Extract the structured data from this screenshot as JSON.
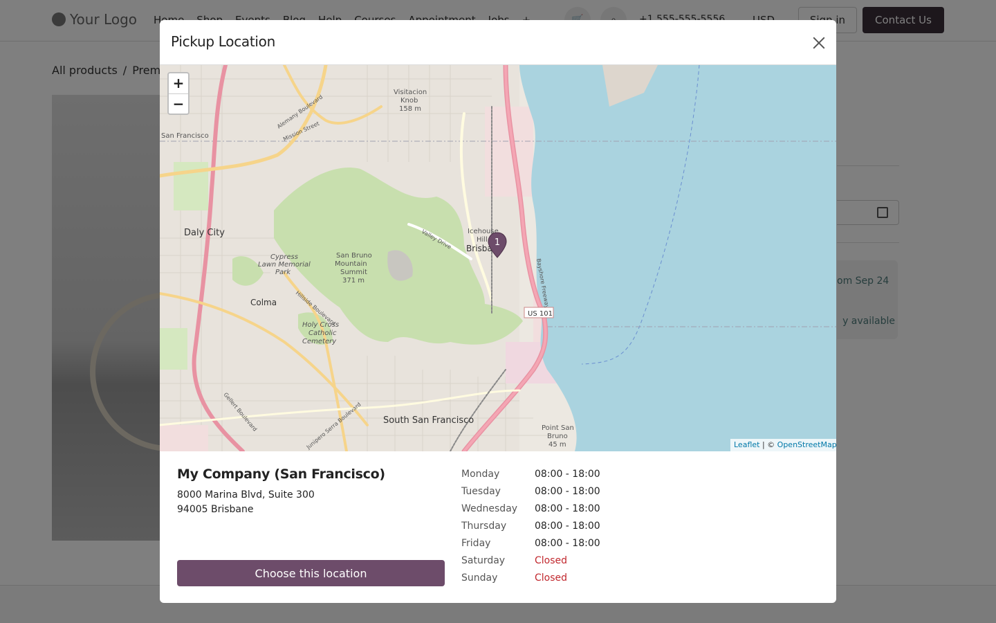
{
  "header": {
    "logo_text": "Your Logo",
    "nav": [
      "Home",
      "Shop",
      "Events",
      "Blog",
      "Help",
      "Courses",
      "Appointment",
      "Jobs",
      "+"
    ],
    "phone": "+1 555-555-5556",
    "currency": "USD",
    "sign_in": "Sign in",
    "contact": "Contact Us"
  },
  "breadcrumb": [
    "All products",
    "/",
    "Premi"
  ],
  "background": {
    "availability_text": "om Sep 24",
    "availability_text_2": "y available"
  },
  "modal": {
    "title": "Pickup Location",
    "map": {
      "zoom_in": "+",
      "zoom_out": "−",
      "marker_label": "1",
      "attribution_leaflet": "Leaflet",
      "attribution_sep": " | © ",
      "attribution_osm": "OpenStreetMap",
      "place_labels": {
        "visitacion": "Visitacion Knob",
        "visitacion_elev": "158 m",
        "san_francisco": "San Francisco",
        "daly_city": "Daly City",
        "cypress": "Cypress Lawn Memorial Park",
        "san_bruno_mtn": "San Bruno Mountain Summit",
        "san_bruno_elev": "371 m",
        "colma": "Colma",
        "holy_cross": "Holy Cross Catholic Cemetery",
        "icehouse": "Icehouse Hill",
        "brisbane": "Brisbane",
        "south_sf": "South San Francisco",
        "point_san_bruno": "Point San Bruno",
        "point_san_bruno_elev": "45 m",
        "us101": "US 101",
        "bayshore": "Bayshore Freeway",
        "valley_drive": "Valley Drive",
        "hillside": "Hillside Boulevard",
        "alemany": "Alemany Boulevard",
        "mission": "Mission Street",
        "gellert": "Gellert Boulevard",
        "junipero": "Junipero Serra Boulevard"
      }
    },
    "location": {
      "name": "My Company (San Francisco)",
      "address_line1": "8000 Marina Blvd, Suite 300",
      "address_line2": "94005 Brisbane"
    },
    "hours": [
      {
        "day": "Monday",
        "time": "08:00 - 18:00",
        "closed": false
      },
      {
        "day": "Tuesday",
        "time": "08:00 - 18:00",
        "closed": false
      },
      {
        "day": "Wednesday",
        "time": "08:00 - 18:00",
        "closed": false
      },
      {
        "day": "Thursday",
        "time": "08:00 - 18:00",
        "closed": false
      },
      {
        "day": "Friday",
        "time": "08:00 - 18:00",
        "closed": false
      },
      {
        "day": "Saturday",
        "time": "Closed",
        "closed": true
      },
      {
        "day": "Sunday",
        "time": "Closed",
        "closed": true
      }
    ],
    "choose_button": "Choose this location"
  },
  "colors": {
    "primary": "#6d4c6a",
    "contact_btn": "#3a2e39",
    "closed": "#c1272d",
    "water": "#aad3df",
    "park": "#c8dfae"
  }
}
